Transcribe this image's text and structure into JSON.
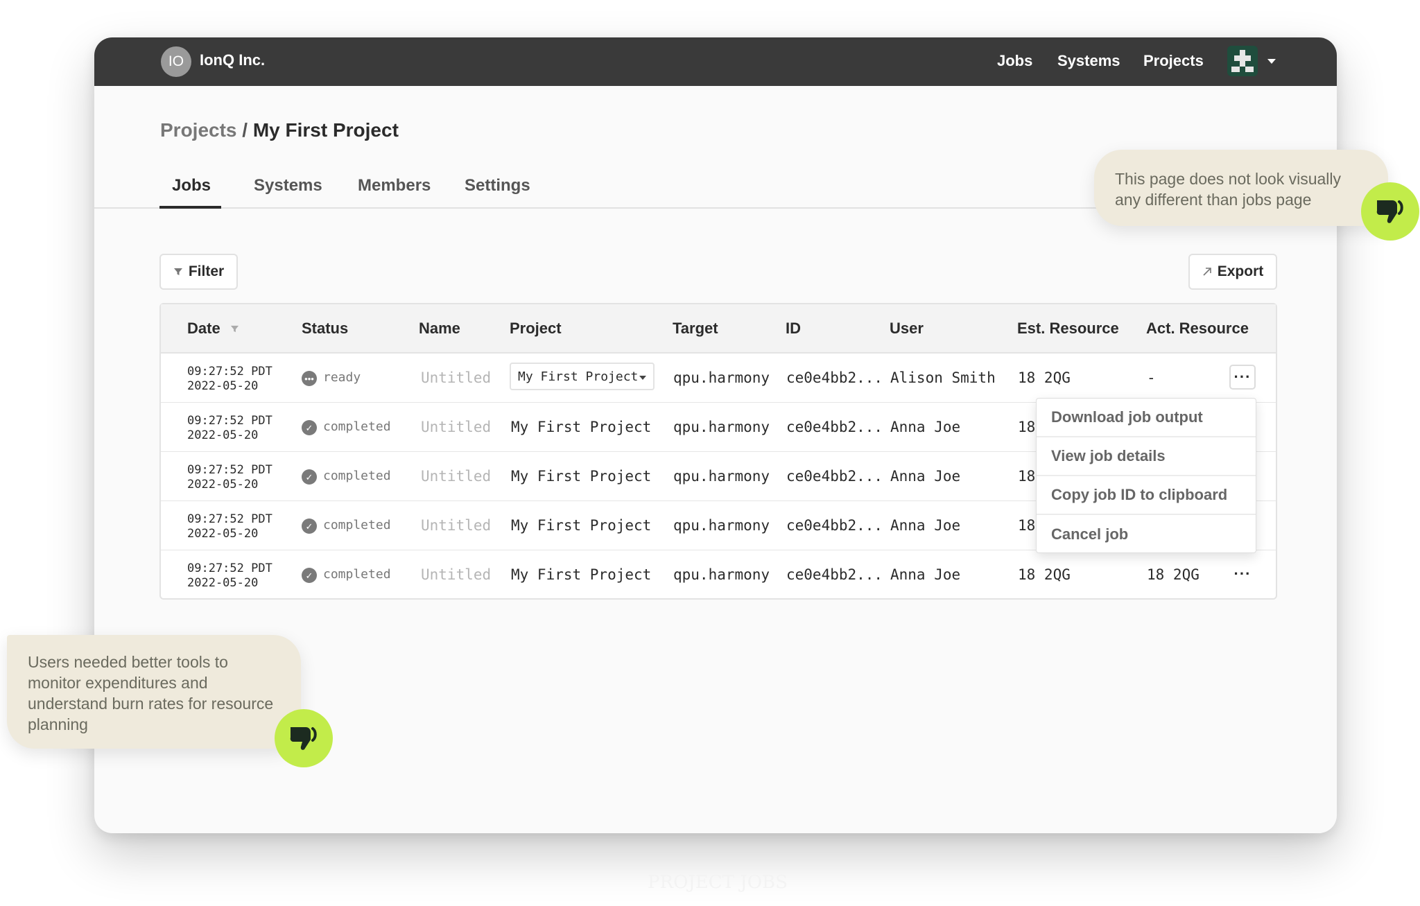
{
  "topnav": {
    "org_initials": "IO",
    "org_name": "IonQ Inc.",
    "links": [
      "Jobs",
      "Systems",
      "Projects"
    ]
  },
  "breadcrumb": {
    "parent": "Projects",
    "separator": "/",
    "current": "My First Project"
  },
  "tabs": [
    {
      "label": "Jobs",
      "active": true
    },
    {
      "label": "Systems",
      "active": false
    },
    {
      "label": "Members",
      "active": false
    },
    {
      "label": "Settings",
      "active": false
    }
  ],
  "toolbar": {
    "filter_label": "Filter",
    "export_label": "Export"
  },
  "table": {
    "columns": [
      "Date",
      "Status",
      "Name",
      "Project",
      "Target",
      "ID",
      "User",
      "Est. Resource",
      "Act. Resource"
    ],
    "rows": [
      {
        "time": "09:27:52 PDT",
        "date": "2022-05-20",
        "status": "ready",
        "name": "Untitled",
        "project": "My First Project",
        "target": "qpu.harmony",
        "id": "ce0e4bb2...",
        "user": "Alison Smith",
        "est": "18 2QG",
        "act": "-"
      },
      {
        "time": "09:27:52 PDT",
        "date": "2022-05-20",
        "status": "completed",
        "name": "Untitled",
        "project": "My First Project",
        "target": "qpu.harmony",
        "id": "ce0e4bb2...",
        "user": "Anna Joe",
        "est": "18",
        "act": ""
      },
      {
        "time": "09:27:52 PDT",
        "date": "2022-05-20",
        "status": "completed",
        "name": "Untitled",
        "project": "My First Project",
        "target": "qpu.harmony",
        "id": "ce0e4bb2...",
        "user": "Anna Joe",
        "est": "18",
        "act": ""
      },
      {
        "time": "09:27:52 PDT",
        "date": "2022-05-20",
        "status": "completed",
        "name": "Untitled",
        "project": "My First Project",
        "target": "qpu.harmony",
        "id": "ce0e4bb2...",
        "user": "Anna Joe",
        "est": "18",
        "act": ""
      },
      {
        "time": "09:27:52 PDT",
        "date": "2022-05-20",
        "status": "completed",
        "name": "Untitled",
        "project": "My First Project",
        "target": "qpu.harmony",
        "id": "ce0e4bb2...",
        "user": "Anna Joe",
        "est": "18 2QG",
        "act": "18 2QG"
      }
    ]
  },
  "row_menu": {
    "items": [
      "Download job output",
      "View job details",
      "Copy job ID to clipboard",
      "Cancel job"
    ]
  },
  "annotations": {
    "note_1": "This page does not look visually any different than jobs page",
    "note_2": "Users needed better tools to monitor expenditures and understand burn rates for resource planning",
    "badge_color": "#c2ec4a"
  },
  "caption": "PROJECT JOBS",
  "colors": {
    "topnav": "#3a3a3a",
    "note_bg": "#efeadc",
    "accent": "#c2ec4a"
  }
}
